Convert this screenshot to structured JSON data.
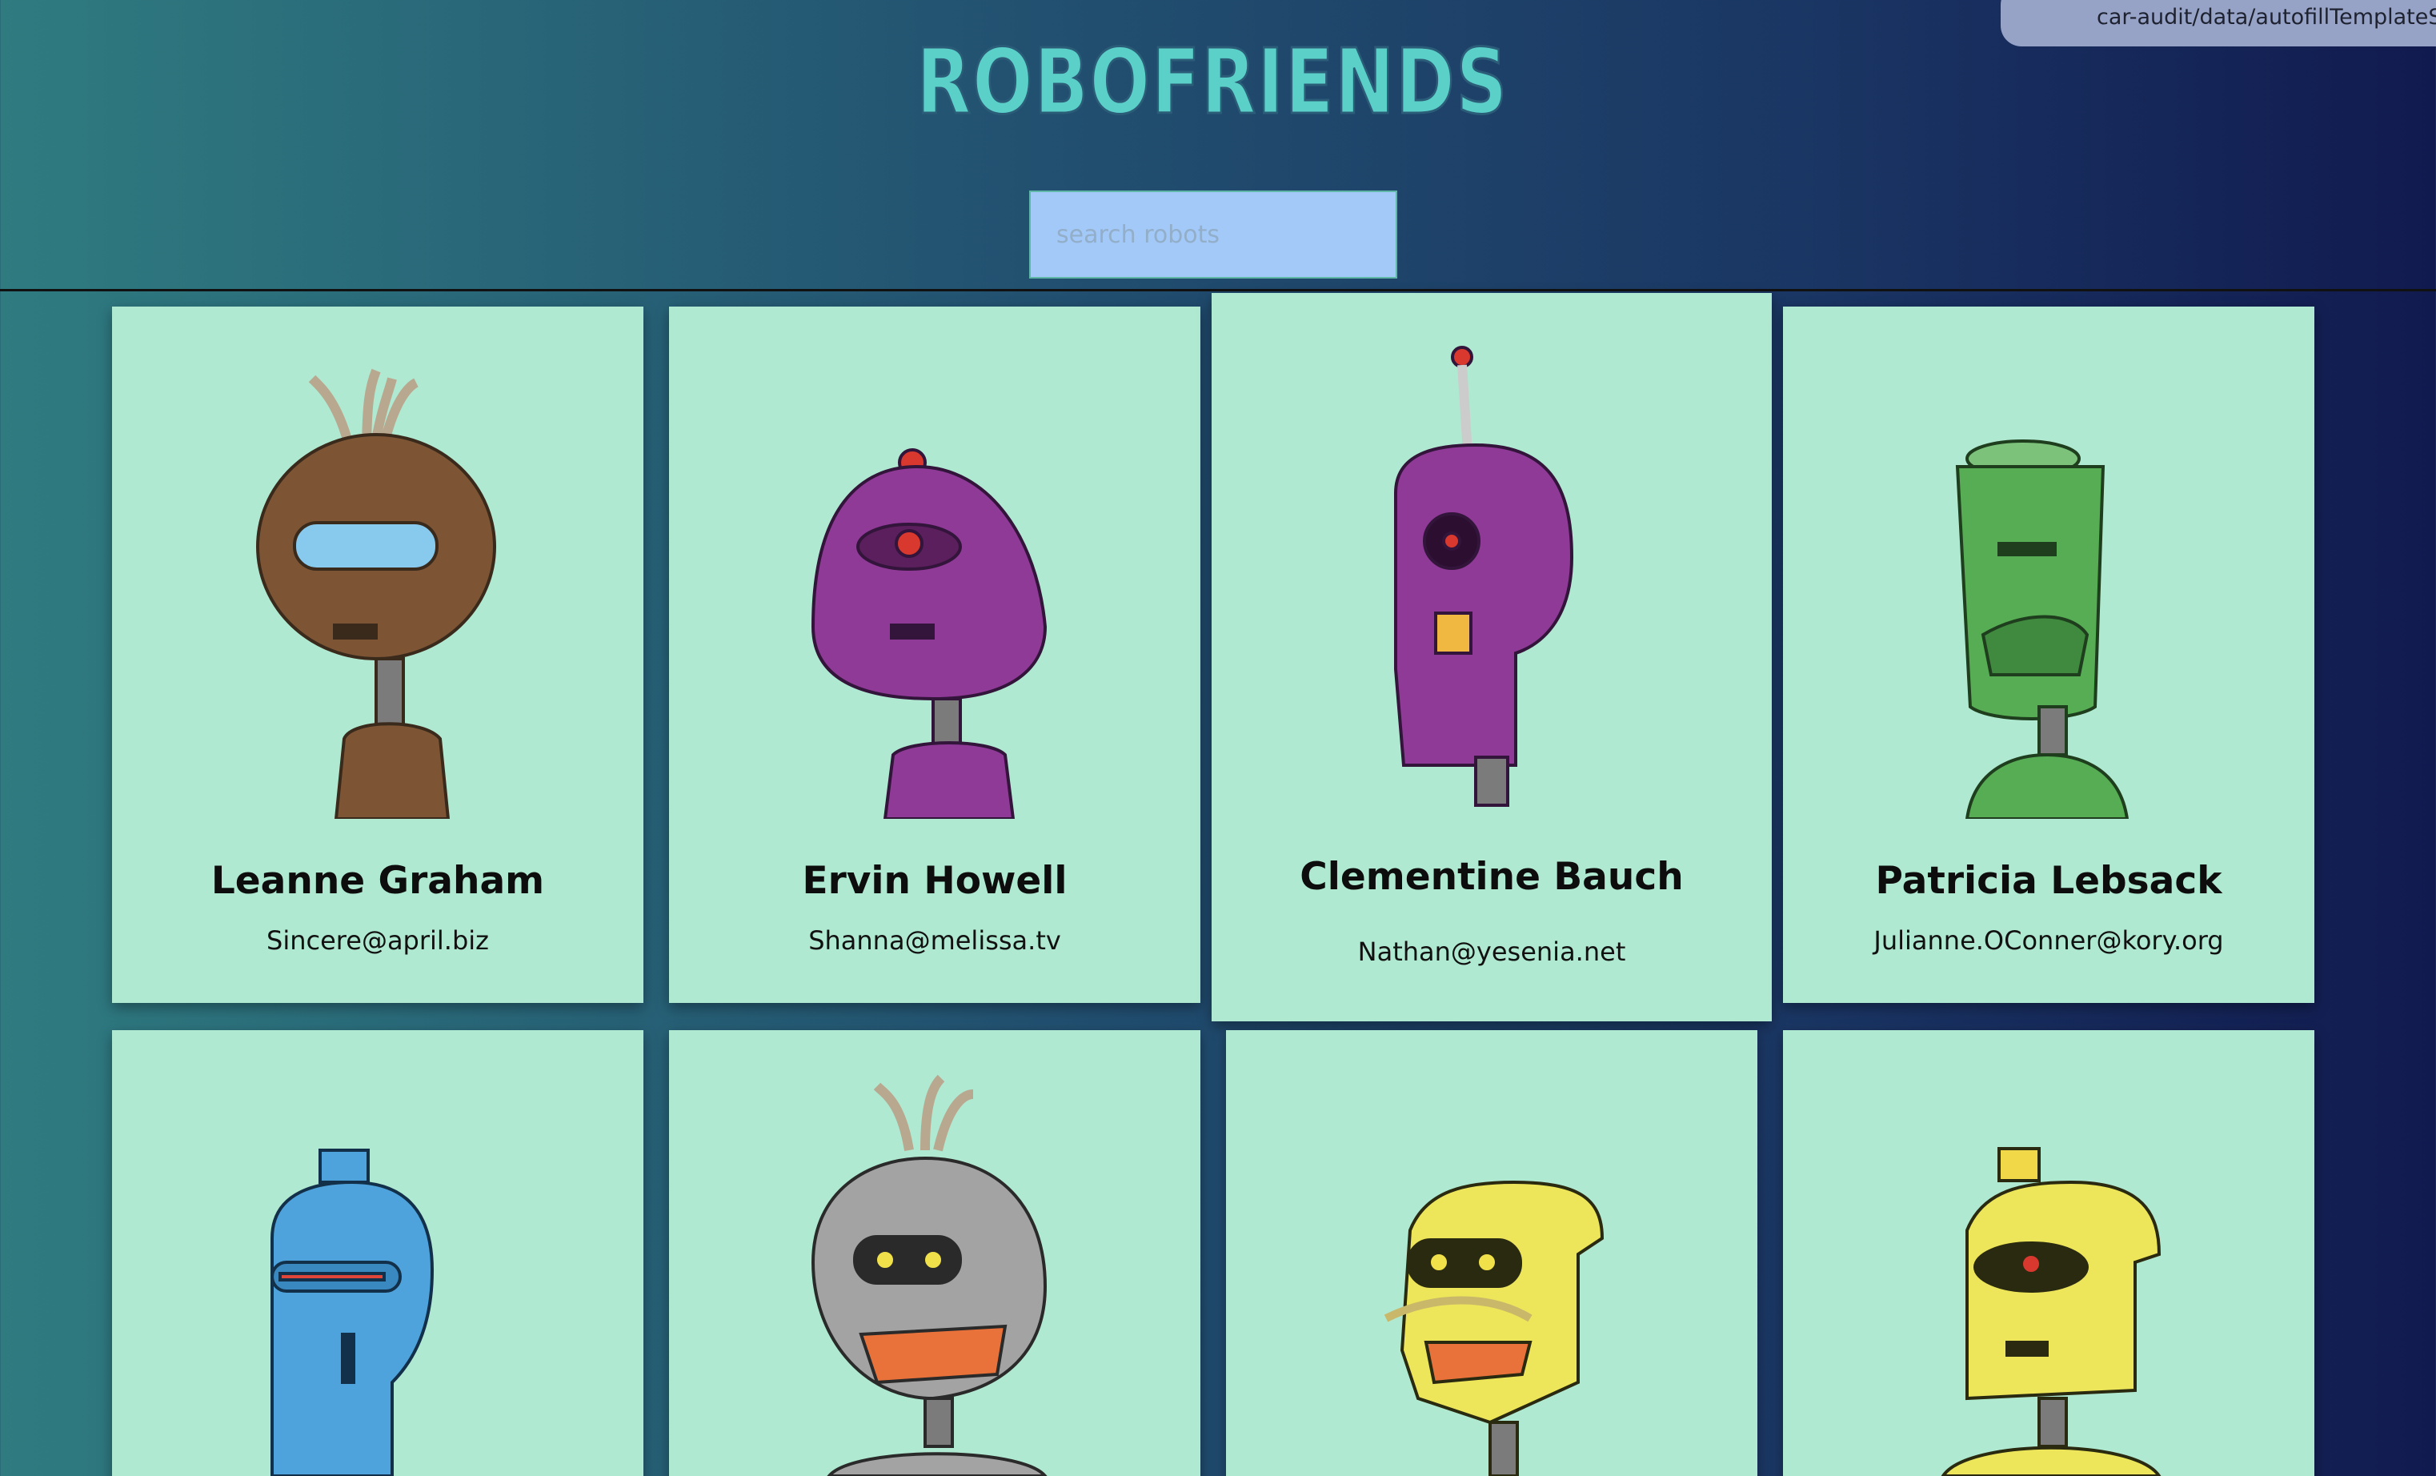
{
  "app": {
    "title": "ROBOFRIENDS",
    "toast_text": "car-audit/data/autofillTemplateSchema"
  },
  "search": {
    "placeholder": "search robots",
    "value": ""
  },
  "colors": {
    "logo": "#5ad0c9",
    "card_bg": "#b0e9d1",
    "search_bg": "#a3c9f8"
  },
  "robots": [
    {
      "name": "Leanne Graham",
      "email": "Sincere@april.biz",
      "color": "#7d5535",
      "icon": "brown-robot-icon"
    },
    {
      "name": "Ervin Howell",
      "email": "Shanna@melissa.tv",
      "color": "#8e3a96",
      "icon": "purple-robot-icon"
    },
    {
      "name": "Clementine Bauch",
      "email": "Nathan@yesenia.net",
      "color": "#8e3a96",
      "icon": "purple-cyclops-robot-icon"
    },
    {
      "name": "Patricia Lebsack",
      "email": "Julianne.OConner@kory.org",
      "color": "#56ad54",
      "icon": "green-robot-icon"
    },
    {
      "name": "",
      "email": "",
      "color": "#4ea3dc",
      "icon": "blue-robot-icon"
    },
    {
      "name": "",
      "email": "",
      "color": "#a3a3a3",
      "icon": "grey-robot-icon"
    },
    {
      "name": "",
      "email": "",
      "color": "#ede55a",
      "icon": "yellow-mustache-robot-icon"
    },
    {
      "name": "",
      "email": "",
      "color": "#ede55a",
      "icon": "yellow-robot-icon"
    }
  ]
}
